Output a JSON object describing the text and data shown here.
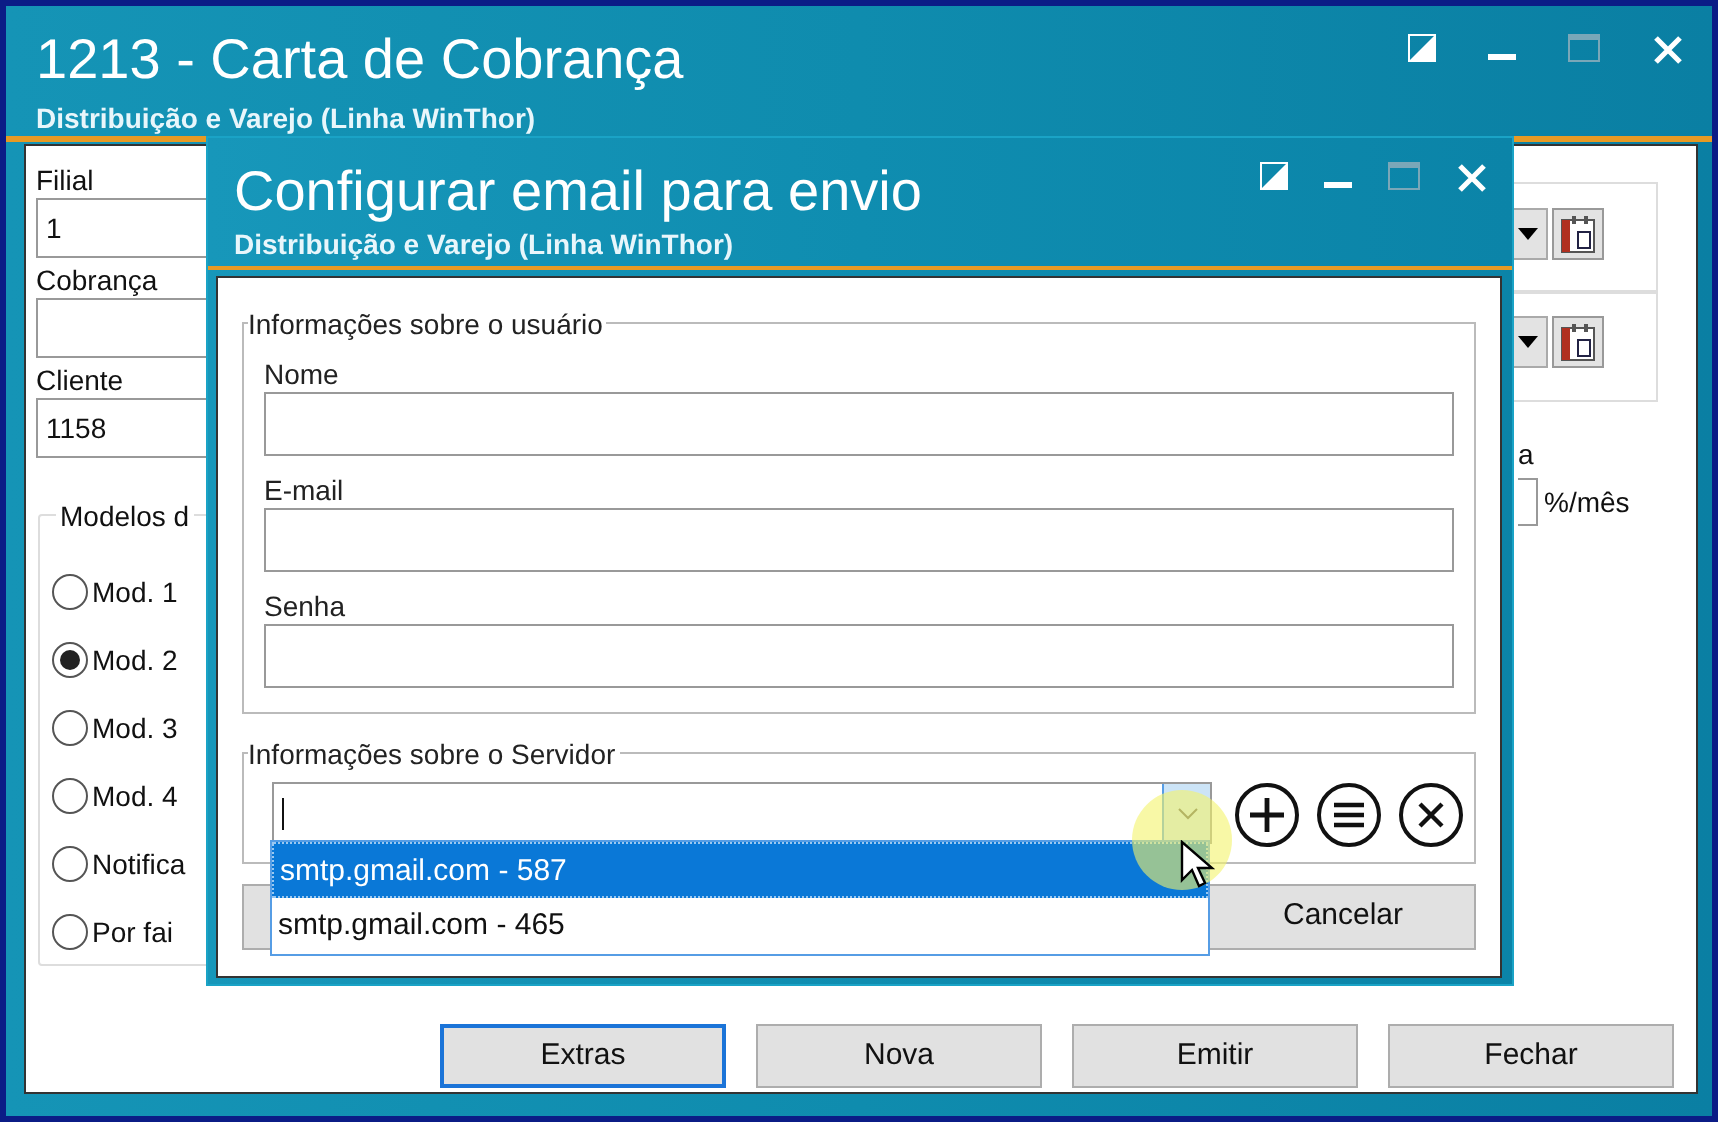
{
  "window": {
    "title": "1213 - Carta de Cobrança",
    "subtitle": "Distribuição e Varejo (Linha WinThor)"
  },
  "form": {
    "fields": [
      {
        "label": "Filial",
        "value": "1"
      },
      {
        "label": "Cobrança"
      },
      {
        "label": "Cliente",
        "value": "1158"
      }
    ]
  },
  "models_group": {
    "title": "Modelos d",
    "options": [
      {
        "label": "Mod. 1",
        "selected": false
      },
      {
        "label": "Mod. 2",
        "selected": true
      },
      {
        "label": "Mod. 3",
        "selected": false
      },
      {
        "label": "Mod. 4",
        "selected": false
      },
      {
        "label": "Notifica",
        "selected": false
      },
      {
        "label": "Por fai",
        "selected": false
      }
    ]
  },
  "right_panel": {
    "label_fragment": "a",
    "unit": "%/mês"
  },
  "buttons": [
    {
      "label": "Extras",
      "focused": true
    },
    {
      "label": "Nova",
      "focused": false
    },
    {
      "label": "Emitir",
      "focused": false
    },
    {
      "label": "Fechar",
      "focused": false
    }
  ],
  "dialog": {
    "title": "Configurar email para envio",
    "subtitle": "Distribuição e Varejo (Linha WinThor)",
    "user_group": {
      "title": "Informações sobre o usuário",
      "fields": [
        {
          "label": "Nome"
        },
        {
          "label": "E-mail"
        },
        {
          "label": "Senha"
        }
      ]
    },
    "server_group": {
      "title": "Informações sobre o Servidor",
      "dropdown": {
        "expanded": true,
        "options": [
          {
            "label": "smtp.gmail.com - 587",
            "selected": true
          },
          {
            "label": "smtp.gmail.com - 465",
            "selected": false
          }
        ]
      }
    },
    "buttons": [
      {
        "label": "Cancelar"
      }
    ]
  }
}
